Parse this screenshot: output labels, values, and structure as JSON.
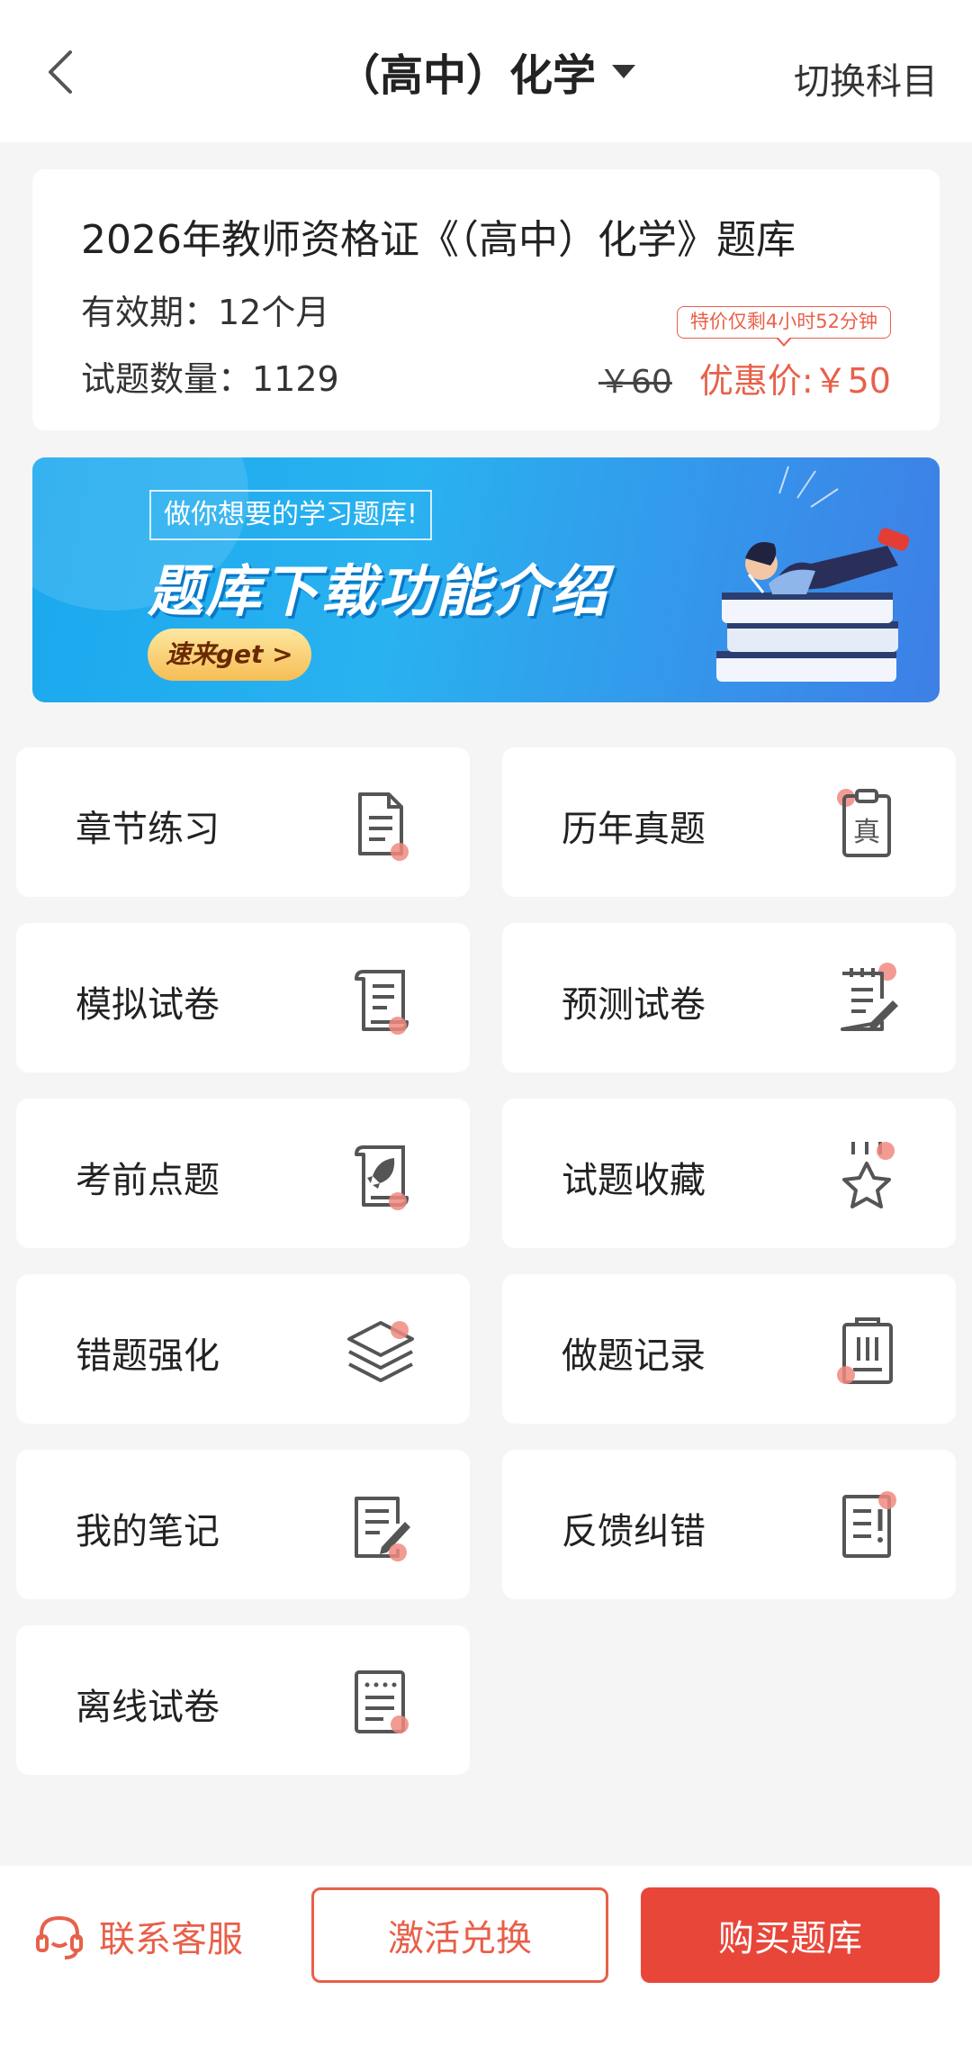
{
  "header": {
    "title": "（高中）化学",
    "switch_label": "切换科目"
  },
  "product": {
    "title": "2026年教师资格证《（高中）化学》题库",
    "validity": "有效期：12个月",
    "question_count": "试题数量：1129",
    "sale_tag": "特价仅剩4小时52分钟",
    "original_price": "￥60",
    "discount_price": "优惠价:￥50"
  },
  "banner": {
    "subtitle": "做你想要的学习题库!",
    "title": "题库下载功能介绍",
    "button": "速来get >"
  },
  "features": [
    {
      "label": "章节练习",
      "icon": "document-icon"
    },
    {
      "label": "历年真题",
      "icon": "past-exam-icon"
    },
    {
      "label": "模拟试卷",
      "icon": "scroll-icon"
    },
    {
      "label": "预测试卷",
      "icon": "notepad-pencil-icon"
    },
    {
      "label": "考前点题",
      "icon": "rocket-icon"
    },
    {
      "label": "试题收藏",
      "icon": "star-icon"
    },
    {
      "label": "错题强化",
      "icon": "layers-icon"
    },
    {
      "label": "做题记录",
      "icon": "clipboard-icon"
    },
    {
      "label": "我的笔记",
      "icon": "edit-note-icon"
    },
    {
      "label": "反馈纠错",
      "icon": "feedback-icon"
    },
    {
      "label": "离线试卷",
      "icon": "offline-paper-icon"
    }
  ],
  "footer": {
    "service_label": "联系客服",
    "activate_label": "激活兑换",
    "buy_label": "购买题库"
  },
  "colors": {
    "accent": "#e8604a",
    "buy_button": "#e9463a",
    "icon_dot": "#f08a80"
  }
}
